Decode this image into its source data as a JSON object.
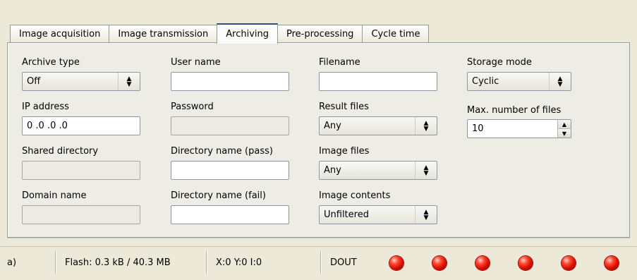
{
  "tabs": [
    {
      "label": "Image acquisition",
      "active": false
    },
    {
      "label": "Image transmission",
      "active": false
    },
    {
      "label": "Archiving",
      "active": true
    },
    {
      "label": "Pre-processing",
      "active": false
    },
    {
      "label": "Cycle time",
      "active": false
    }
  ],
  "col1": {
    "archive_type_label": "Archive type",
    "archive_type_value": "Off",
    "ip_address_label": "IP address",
    "ip_address_value": "0 .0 .0 .0",
    "shared_directory_label": "Shared directory",
    "shared_directory_value": "",
    "domain_name_label": "Domain name",
    "domain_name_value": ""
  },
  "col2": {
    "user_name_label": "User name",
    "user_name_value": "",
    "password_label": "Password",
    "password_value": "",
    "dir_pass_label": "Directory name (pass)",
    "dir_pass_value": "",
    "dir_fail_label": "Directory name (fail)",
    "dir_fail_value": ""
  },
  "col3": {
    "filename_label": "Filename",
    "filename_value": "",
    "result_files_label": "Result files",
    "result_files_value": "Any",
    "image_files_label": "Image files",
    "image_files_value": "Any",
    "image_contents_label": "Image contents",
    "image_contents_value": "Unfiltered"
  },
  "col4": {
    "storage_mode_label": "Storage mode",
    "storage_mode_value": "Cyclic",
    "max_files_label": "Max. number of files",
    "max_files_value": "10"
  },
  "status_bar": {
    "left_fragment": "a)",
    "flash": "Flash:  0.3 kB / 40.3 MB",
    "coords": "X:0 Y:0 I:0",
    "dout_label": "DOUT",
    "led_color": "#e00a00",
    "led_count": 6
  }
}
